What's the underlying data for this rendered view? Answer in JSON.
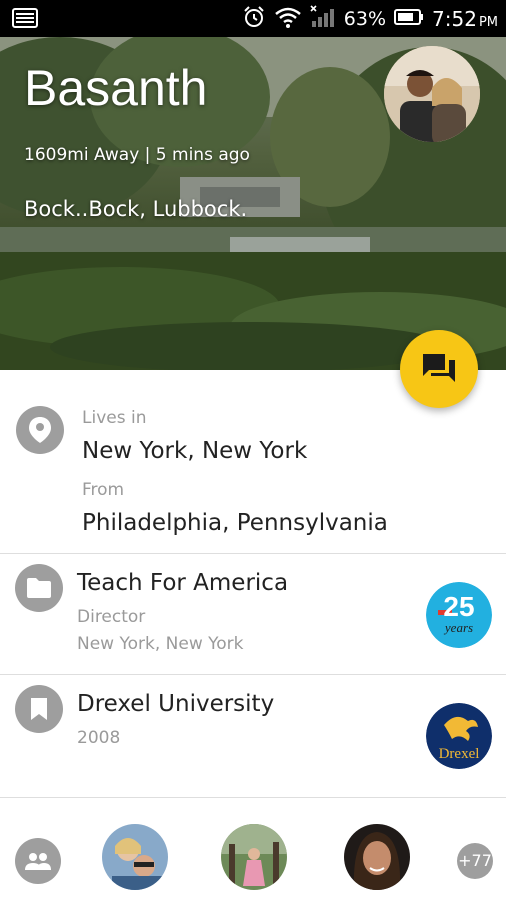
{
  "status_bar": {
    "battery": "63%",
    "time": "7:52",
    "ampm": "PM",
    "icons": [
      "screenshot-icon",
      "alarm-icon",
      "wifi-icon",
      "signal-icon",
      "battery-icon"
    ]
  },
  "profile": {
    "name": "Basanth",
    "meta": "1609mi Away | 5 mins ago",
    "status": "Bock..Bock, Lubbock."
  },
  "location": {
    "lives_label": "Lives in",
    "lives_value": "New York, New York",
    "from_label": "From",
    "from_value": "Philadelphia, Pennsylvania"
  },
  "work": {
    "employer": "Teach For America",
    "title": "Director",
    "location": "New York, New York",
    "logo_number": "25",
    "logo_word": "years"
  },
  "education": {
    "school": "Drexel University",
    "year": "2008",
    "logo_word": "Drexel"
  },
  "friends": {
    "more_count": "+77"
  },
  "colors": {
    "fab": "#f7c615",
    "icon_grey": "#9e9e9e",
    "status_bar": "#000000"
  }
}
